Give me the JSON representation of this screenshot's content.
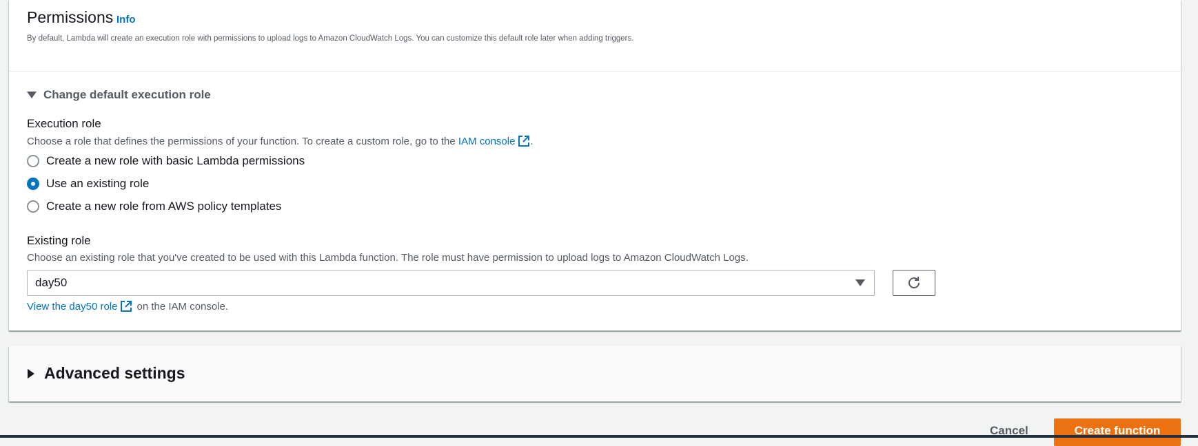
{
  "permissions": {
    "title": "Permissions",
    "info_link": "Info",
    "description": "By default, Lambda will create an execution role with permissions to upload logs to Amazon CloudWatch Logs. You can customize this default role later when adding triggers."
  },
  "change_role": {
    "expander_label": "Change default execution role",
    "execution_role": {
      "label": "Execution role",
      "description_prefix": "Choose a role that defines the permissions of your function. To create a custom role, go to the ",
      "iam_console_link": "IAM console",
      "description_suffix": ".",
      "options": [
        {
          "label": "Create a new role with basic Lambda permissions",
          "selected": false
        },
        {
          "label": "Use an existing role",
          "selected": true
        },
        {
          "label": "Create a new role from AWS policy templates",
          "selected": false
        }
      ]
    },
    "existing_role": {
      "label": "Existing role",
      "description": "Choose an existing role that you've created to be used with this Lambda function. The role must have permission to upload logs to Amazon CloudWatch Logs.",
      "selected_value": "day50",
      "view_link": "View the day50 role",
      "view_suffix": "on the IAM console."
    }
  },
  "advanced": {
    "label": "Advanced settings"
  },
  "footer": {
    "cancel_label": "Cancel",
    "create_label": "Create function"
  },
  "colors": {
    "link": "#0073bb",
    "primary_button": "#ec7211",
    "radio_selected": "#0073bb"
  },
  "icons": [
    "external-link-icon",
    "refresh-icon",
    "caret-down-icon",
    "caret-right-icon"
  ]
}
